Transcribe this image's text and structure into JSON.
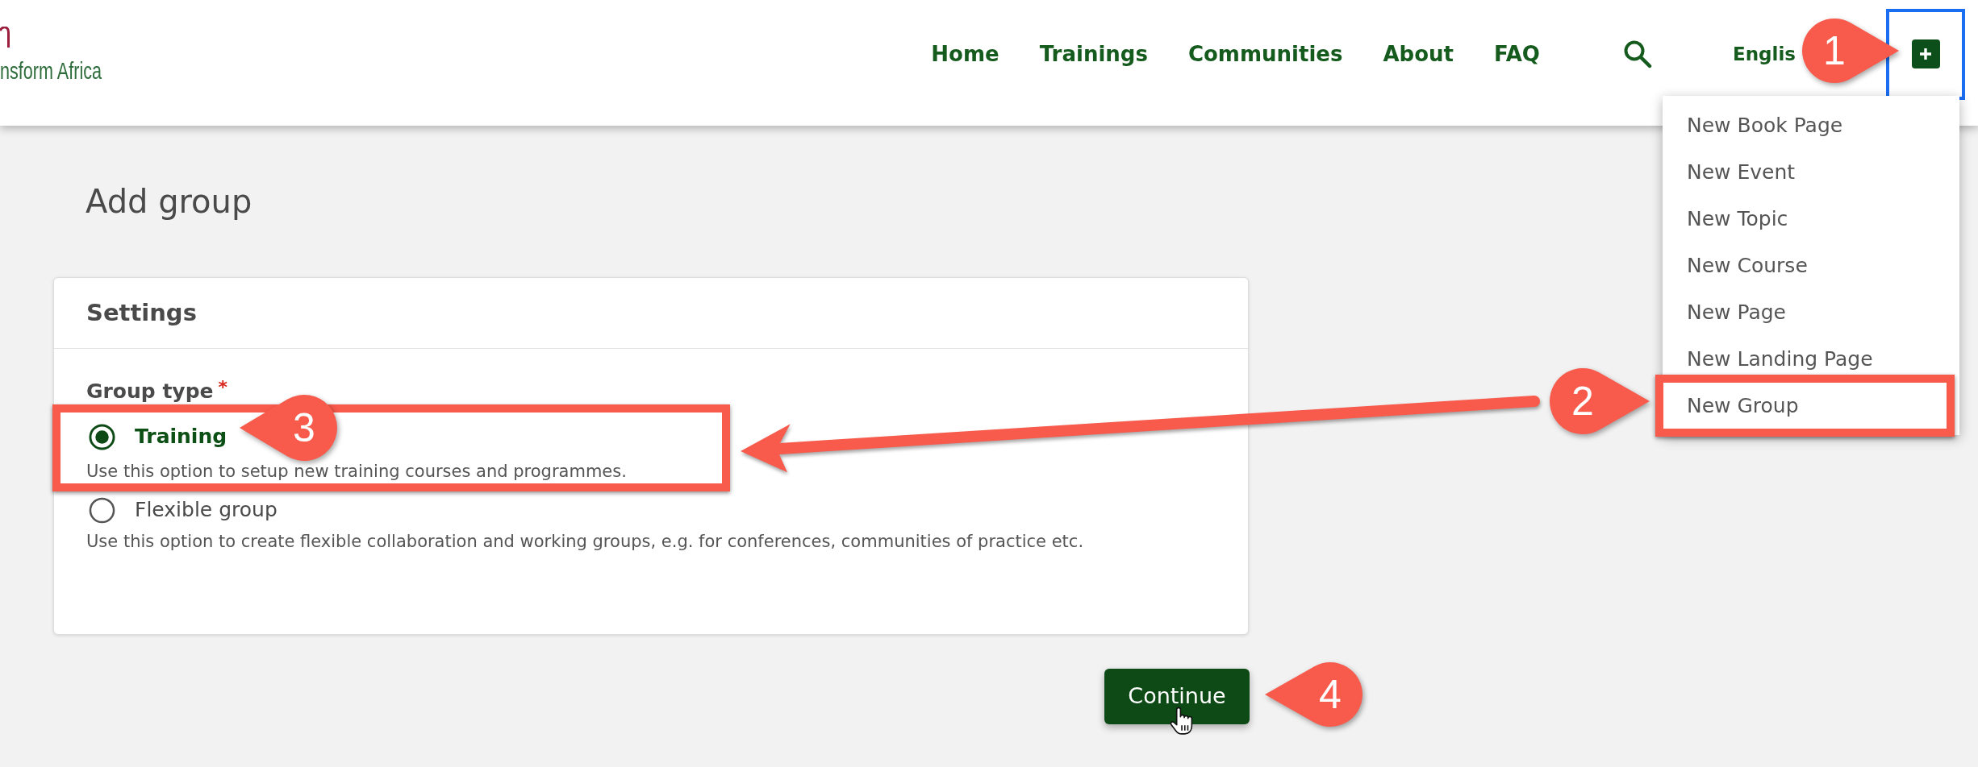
{
  "header": {
    "logo": {
      "tagline": "nsform Africa"
    },
    "nav": [
      "Home",
      "Trainings",
      "Communities",
      "About",
      "FAQ"
    ],
    "language": "Englis",
    "add_button": {
      "focused": true
    },
    "add_menu": {
      "expanded": true,
      "items": [
        "New Book Page",
        "New Event",
        "New Topic",
        "New Course",
        "New Page",
        "New Landing Page",
        "New Group"
      ]
    }
  },
  "page": {
    "title": "Add group",
    "settings_card": {
      "title": "Settings",
      "field": {
        "label": "Group type",
        "required_mark": "*",
        "options": [
          {
            "label": "Training",
            "description": "Use this option to setup new training courses and programmes.",
            "selected": true
          },
          {
            "label": "Flexible group",
            "description": "Use this option to create flexible collaboration and working groups, e.g. for conferences, communities of practice etc.",
            "selected": false
          }
        ]
      }
    },
    "continue_button": "Continue"
  },
  "annotations": {
    "callouts": [
      {
        "number": "1"
      },
      {
        "number": "2"
      },
      {
        "number": "3"
      },
      {
        "number": "4"
      }
    ]
  }
}
